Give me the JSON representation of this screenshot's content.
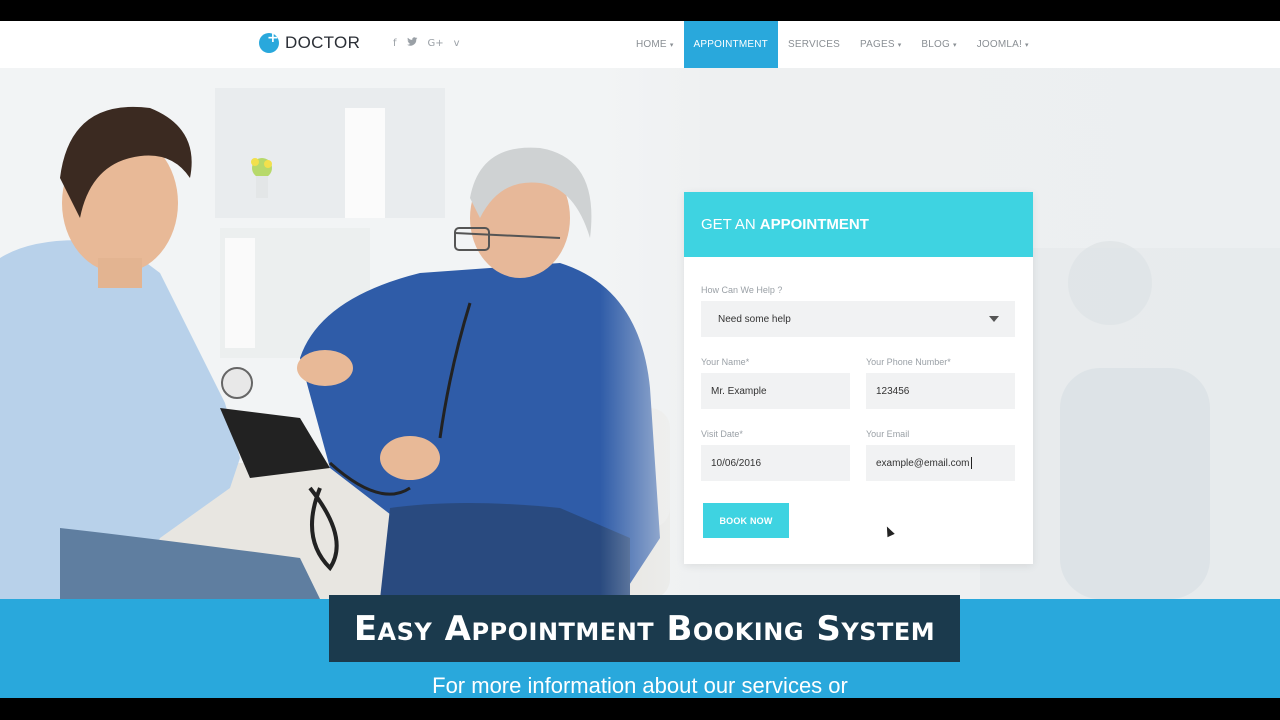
{
  "header": {
    "logo_text": "DOCTOR",
    "social": [
      "f",
      "t",
      "G+",
      "v"
    ],
    "nav": [
      {
        "label": "HOME",
        "caret": "▾"
      },
      {
        "label": "APPOINTMENT",
        "caret": ""
      },
      {
        "label": "SERVICES",
        "caret": ""
      },
      {
        "label": "PAGES",
        "caret": "▾"
      },
      {
        "label": "BLOG",
        "caret": "▾"
      },
      {
        "label": "JOOMLA!",
        "caret": "▾"
      }
    ],
    "active_nav": "APPOINTMENT"
  },
  "form": {
    "title_light": "GET AN",
    "title_bold": "APPOINTMENT",
    "help_label": "How Can We Help ?",
    "help_value": "Need some help",
    "name_label": "Your Name*",
    "name_value": "Mr. Example",
    "phone_label": "Your Phone Number*",
    "phone_value": "123456",
    "date_label": "Visit Date*",
    "date_value": "10/06/2016",
    "email_label": "Your Email",
    "email_value": "example@email.com",
    "submit_label": "BOOK NOW"
  },
  "banner": {
    "caption": "Easy Appointment Booking System",
    "subcaption": "For more information about our services or"
  },
  "colors": {
    "accent": "#29a8dc",
    "form_accent": "#3ed3e1",
    "caption_bg": "#1b3a4d"
  }
}
